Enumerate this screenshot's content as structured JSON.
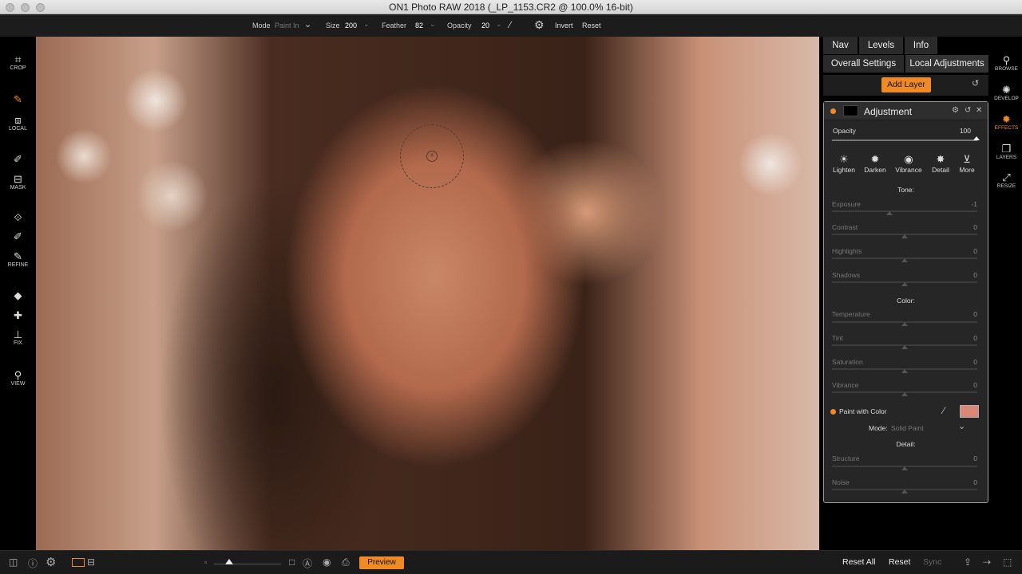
{
  "window": {
    "title": "ON1 Photo RAW 2018 (_LP_1153.CR2 @ 100.0% 16-bit)"
  },
  "options": {
    "mode_label": "Mode",
    "mode_value": "Paint In",
    "size_label": "Size",
    "size_value": "200",
    "feather_label": "Feather",
    "feather_value": "82",
    "opacity_label": "Opacity",
    "opacity_value": "20",
    "invert": "Invert",
    "reset": "Reset"
  },
  "left_tools": {
    "crop": "CROP",
    "local": "LOCAL",
    "mask": "MASK",
    "refine": "REFINE",
    "fix": "FIX",
    "view": "VIEW"
  },
  "right_tools": {
    "browse": "BROWSE",
    "develop": "DEVELOP",
    "effects": "EFFECTS",
    "layers": "LAYERS",
    "resize": "RESIZE",
    "active": "effects"
  },
  "panel": {
    "tabs": [
      "Nav",
      "Levels",
      "Info"
    ],
    "subtabs": [
      "Overall Settings",
      "Local Adjustments"
    ],
    "add_layer": "Add Layer",
    "adjustment": {
      "title": "Adjustment",
      "opacity_label": "Opacity",
      "opacity_value": "100",
      "presets": [
        "Lighten",
        "Darken",
        "Vibrance",
        "Detail",
        "More"
      ],
      "tone_header": "Tone:",
      "tone": [
        {
          "label": "Exposure",
          "value": "-1"
        },
        {
          "label": "Contrast",
          "value": "0"
        },
        {
          "label": "Highlights",
          "value": "0"
        },
        {
          "label": "Shadows",
          "value": "0"
        }
      ],
      "color_header": "Color:",
      "color": [
        {
          "label": "Temperature",
          "value": "0"
        },
        {
          "label": "Tint",
          "value": "0"
        },
        {
          "label": "Saturation",
          "value": "0"
        },
        {
          "label": "Vibrance",
          "value": "0"
        }
      ],
      "paint_with_color": "Paint with Color",
      "paint_color": "#d98878",
      "mode_label": "Mode:",
      "mode_value": "Solid Paint",
      "detail_header": "Detail:",
      "detail": [
        {
          "label": "Structure",
          "value": "0"
        },
        {
          "label": "Noise",
          "value": "0"
        }
      ]
    }
  },
  "bottom": {
    "preview": "Preview",
    "reset_all": "Reset All",
    "reset": "Reset",
    "sync": "Sync"
  },
  "colors": {
    "accent": "#f08a24"
  }
}
